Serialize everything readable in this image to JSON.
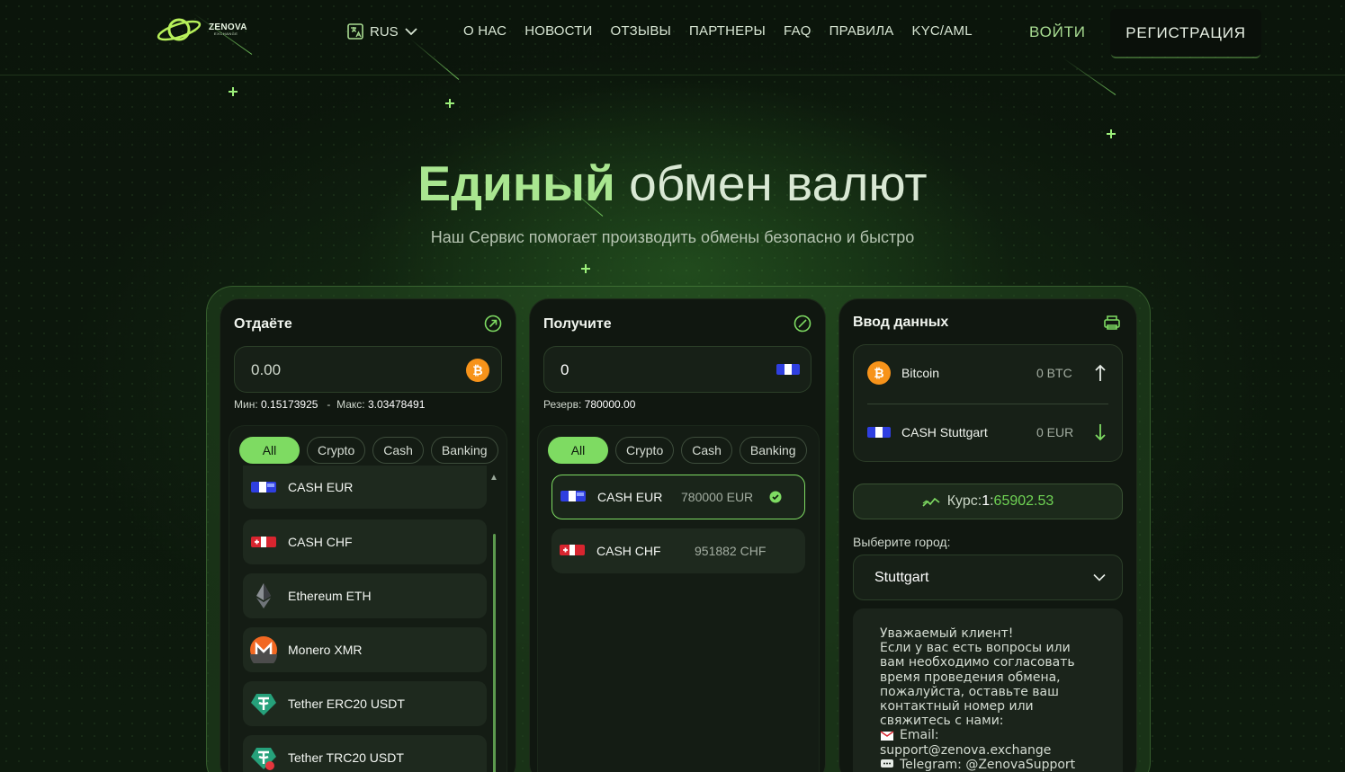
{
  "brand": {
    "name": "ZENOVA",
    "sub": "EXCHANGE"
  },
  "header": {
    "lang": "RUS",
    "nav": [
      "О НАС",
      "НОВОСТИ",
      "ОТЗЫВЫ",
      "ПАРТНЕРЫ",
      "FAQ",
      "ПРАВИЛА",
      "KYC/AML"
    ],
    "login": "ВОЙТИ",
    "register": "РЕГИСТРАЦИЯ"
  },
  "hero": {
    "title_bold": "Единый",
    "title_rest": " обмен валют",
    "subtitle": "Наш Сервис помогает производить обмены безопасно и быстро"
  },
  "give": {
    "title": "Отдаёте",
    "amount": "0.00",
    "min_label": "Мин:",
    "min_value": "0.15173925",
    "max_label": "Макс:",
    "max_value": "3.03478491",
    "filters": [
      "All",
      "Crypto",
      "Cash",
      "Banking"
    ],
    "items": [
      {
        "name": "CASH EUR",
        "icon": "eur-cash-icon"
      },
      {
        "name": "CASH CHF",
        "icon": "chf-cash-icon"
      },
      {
        "name": "Ethereum ETH",
        "icon": "ethereum-icon"
      },
      {
        "name": "Monero XMR",
        "icon": "monero-icon"
      },
      {
        "name": "Tether ERC20 USDT",
        "icon": "tether-icon"
      },
      {
        "name": "Tether TRC20 USDT",
        "icon": "tether-trc-icon"
      }
    ]
  },
  "receive": {
    "title": "Получите",
    "amount": "0",
    "reserve_label": "Резерв:",
    "reserve_value": "780000.00",
    "filters": [
      "All",
      "Crypto",
      "Cash",
      "Banking"
    ],
    "items": [
      {
        "name": "CASH EUR",
        "reserve": "780000 EUR",
        "selected": true
      },
      {
        "name": "CASH CHF",
        "reserve": "951882 CHF",
        "selected": false
      }
    ]
  },
  "data_entry": {
    "title": "Ввод данных",
    "from": {
      "name": "Bitcoin",
      "amount": "0 BTC"
    },
    "to": {
      "name": "CASH Stuttgart",
      "amount": "0 EUR"
    },
    "rate_label": "Курс:",
    "rate_one": "1",
    "rate_sep": ":",
    "rate_value": "65902.53",
    "city_label": "Выберите город:",
    "city": "Stuttgart",
    "info_lines": [
      "Уважаемый клиент!",
      "Если у вас есть вопросы или",
      "вам необходимо согласовать",
      "время проведения обмена,",
      "пожалуйста, оставьте ваш",
      "контактный номер или",
      "свяжитесь с нами:"
    ],
    "email_label": "Email:",
    "email": "support@zenova.exchange",
    "telegram": "Telegram: @ZenovaSupport"
  },
  "colors": {
    "accent": "#7edb62",
    "bitcoin": "#f7931a",
    "bg": "#0c170c"
  }
}
